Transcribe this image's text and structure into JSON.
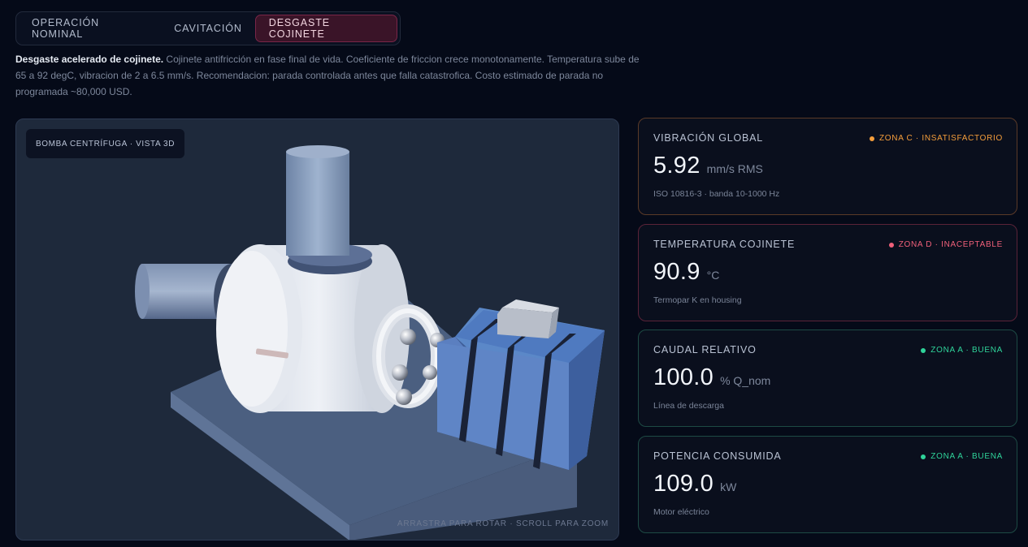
{
  "tabs": [
    {
      "label": "OPERACIÓN NOMINAL",
      "active": false
    },
    {
      "label": "CAVITACIÓN",
      "active": false
    },
    {
      "label": "DESGASTE COJINETE",
      "active": true
    }
  ],
  "description": {
    "title": "Desgaste acelerado de cojinete.",
    "body": " Cojinete antifricción en fase final de vida. Coeficiente de friccion crece monotonamente. Temperatura sube de 65 a 92 degC, vibracion de 2 a 6.5 mm/s. Recomendacion: parada controlada antes que falla catastrofica. Costo estimado de parada no programada ~80,000 USD."
  },
  "viewer": {
    "badge": "BOMBA CENTRÍFUGA · VISTA 3D",
    "hint": "ARRASTRA PARA ROTAR · SCROLL PARA ZOOM"
  },
  "metrics": [
    {
      "label": "VIBRACIÓN GLOBAL",
      "status": "ZONA C · INSATISFACTORIO",
      "status_color": "#f59e3b",
      "border_color": "#5a3a28",
      "value": "5.92",
      "unit": "mm/s RMS",
      "sub": "ISO 10816-3 · banda 10-1000 Hz"
    },
    {
      "label": "TEMPERATURA COJINETE",
      "status": "ZONA D · INACEPTABLE",
      "status_color": "#f0607a",
      "border_color": "#5a2338",
      "value": "90.9",
      "unit": "°C",
      "sub": "Termopar K en housing"
    },
    {
      "label": "CAUDAL RELATIVO",
      "status": "ZONA A · BUENA",
      "status_color": "#2fd39a",
      "border_color": "#1d4a44",
      "value": "100.0",
      "unit": "% Q_nom",
      "sub": "Línea de descarga"
    },
    {
      "label": "POTENCIA CONSUMIDA",
      "status": "ZONA A · BUENA",
      "status_color": "#2fd39a",
      "border_color": "#1d4a44",
      "value": "109.0",
      "unit": "kW",
      "sub": "Motor eléctrico"
    }
  ]
}
